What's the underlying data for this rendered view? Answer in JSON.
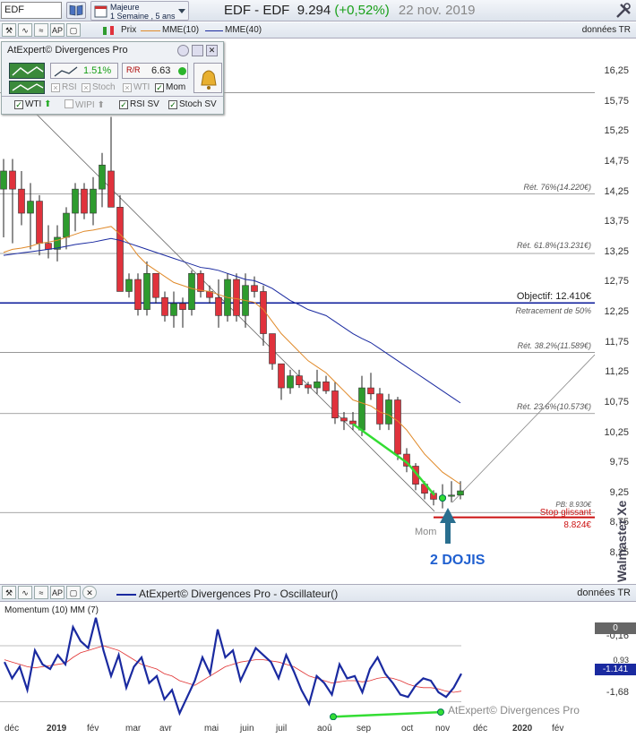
{
  "toolbar": {
    "symbol": "EDF",
    "period_line1": "Majeure",
    "period_line2": "1 Semaine , 5 ans",
    "title_name": "EDF - EDF",
    "title_price": "9.294",
    "title_change": "(+0,52%)",
    "title_date": "22 nov. 2019"
  },
  "legend_bar": {
    "prix": "Prix",
    "mme10": "MME(10)",
    "mme40": "MME(40)",
    "donnees": "données TR"
  },
  "panel": {
    "title": "AtExpert© Divergences Pro",
    "pct": "1.51%",
    "rr": "6.63",
    "checks": [
      {
        "label": "RSI",
        "on": false
      },
      {
        "label": "Stoch",
        "on": false
      },
      {
        "label": "WTI",
        "on": false
      },
      {
        "label": "Mom",
        "on": true
      }
    ],
    "checks2": [
      {
        "label": "WTI",
        "on": true
      },
      {
        "label": "WIPI",
        "on": false
      },
      {
        "label": "RSI SV",
        "on": true
      },
      {
        "label": "Stoch SV",
        "on": true
      }
    ]
  },
  "price_axis": [
    "16,25",
    "15,75",
    "15,25",
    "14,75",
    "14,25",
    "13,75",
    "13,25",
    "12,75",
    "12,25",
    "11,75",
    "11,25",
    "10,75",
    "10,25",
    "9,75",
    "9,25",
    "8,75",
    "8,25"
  ],
  "levels": {
    "ret76": "Rét. 76%(14.220€)",
    "ret618": "Rét. 61.8%(13.231€)",
    "objectif": "Objectif: 12.410€",
    "retr50": "Retracement de 50%",
    "ret382": "Rét. 38.2%(11.589€)",
    "ret236": "Rét. 23.6%(10.573€)",
    "pb": "PB: 8.930€",
    "stop": "Stop glissant",
    "stop_val": "8.824€"
  },
  "annotations": {
    "mom": "Mom",
    "dojis": "2 DOJIS"
  },
  "oscillator_bar": {
    "title": "AtExpert© Divergences Pro - Oscillateur()",
    "donnees": "données TR"
  },
  "oscillator": {
    "label": "Momentum (10) MM (7)",
    "axis": [
      "-0,16",
      "0,93",
      "-1,68"
    ],
    "badge_zero": "0",
    "badge_val": "-1.141",
    "copyright": "AtExpert© Divergences Pro"
  },
  "x_axis": [
    {
      "label": "déc",
      "bold": false
    },
    {
      "label": "2019",
      "bold": true
    },
    {
      "label": "fév",
      "bold": false
    },
    {
      "label": "mar",
      "bold": false
    },
    {
      "label": "avr",
      "bold": false
    },
    {
      "label": "mai",
      "bold": false
    },
    {
      "label": "juin",
      "bold": false
    },
    {
      "label": "juil",
      "bold": false
    },
    {
      "label": "aoû",
      "bold": false
    },
    {
      "label": "sep",
      "bold": false
    },
    {
      "label": "oct",
      "bold": false
    },
    {
      "label": "nov",
      "bold": false
    },
    {
      "label": "déc",
      "bold": false
    },
    {
      "label": "2020",
      "bold": true
    },
    {
      "label": "fév",
      "bold": false
    }
  ],
  "watermark": "Walmaster Xe",
  "colors": {
    "up": "#2e9b2e",
    "down": "#e0323c",
    "mme10": "#e08a2a",
    "mme40": "#1a2aa0",
    "objective": "#0a1a9a",
    "stop": "#cc1111",
    "divergence": "#33dd33",
    "arrow": "#2a6f8f"
  },
  "chart_data": {
    "type": "candlestick",
    "price_min": 8.0,
    "price_max": 16.5,
    "candles": [
      {
        "o": 14.3,
        "h": 14.8,
        "l": 13.5,
        "c": 14.6
      },
      {
        "o": 14.6,
        "h": 14.8,
        "l": 13.4,
        "c": 14.3
      },
      {
        "o": 14.3,
        "h": 14.6,
        "l": 13.7,
        "c": 13.9
      },
      {
        "o": 13.9,
        "h": 14.4,
        "l": 13.3,
        "c": 14.1
      },
      {
        "o": 14.1,
        "h": 14.2,
        "l": 13.2,
        "c": 13.4
      },
      {
        "o": 13.4,
        "h": 13.7,
        "l": 13.15,
        "c": 13.3
      },
      {
        "o": 13.3,
        "h": 13.7,
        "l": 13.1,
        "c": 13.5
      },
      {
        "o": 13.5,
        "h": 14.0,
        "l": 13.3,
        "c": 13.9
      },
      {
        "o": 13.9,
        "h": 14.4,
        "l": 13.6,
        "c": 14.3
      },
      {
        "o": 14.3,
        "h": 14.4,
        "l": 13.8,
        "c": 13.9
      },
      {
        "o": 13.9,
        "h": 14.5,
        "l": 13.7,
        "c": 14.3
      },
      {
        "o": 14.3,
        "h": 14.9,
        "l": 14.0,
        "c": 14.7
      },
      {
        "o": 14.6,
        "h": 15.5,
        "l": 14.2,
        "c": 14.0
      },
      {
        "o": 14.0,
        "h": 14.2,
        "l": 12.9,
        "c": 12.6
      },
      {
        "o": 12.6,
        "h": 12.9,
        "l": 12.5,
        "c": 12.8
      },
      {
        "o": 12.8,
        "h": 12.9,
        "l": 12.2,
        "c": 12.3
      },
      {
        "o": 12.3,
        "h": 13.1,
        "l": 12.2,
        "c": 12.9
      },
      {
        "o": 12.9,
        "h": 12.9,
        "l": 12.4,
        "c": 12.5
      },
      {
        "o": 12.5,
        "h": 12.6,
        "l": 12.1,
        "c": 12.2
      },
      {
        "o": 12.2,
        "h": 12.6,
        "l": 12.0,
        "c": 12.4
      },
      {
        "o": 12.4,
        "h": 12.5,
        "l": 12.0,
        "c": 12.3
      },
      {
        "o": 12.3,
        "h": 12.95,
        "l": 12.2,
        "c": 12.9
      },
      {
        "o": 12.9,
        "h": 12.95,
        "l": 12.5,
        "c": 12.6
      },
      {
        "o": 12.6,
        "h": 12.7,
        "l": 12.4,
        "c": 12.5
      },
      {
        "o": 12.5,
        "h": 12.8,
        "l": 12.0,
        "c": 12.2
      },
      {
        "o": 12.2,
        "h": 12.9,
        "l": 12.1,
        "c": 12.8
      },
      {
        "o": 12.8,
        "h": 12.9,
        "l": 12.1,
        "c": 12.2
      },
      {
        "o": 12.2,
        "h": 12.9,
        "l": 12.0,
        "c": 12.7
      },
      {
        "o": 12.7,
        "h": 12.85,
        "l": 12.5,
        "c": 12.6
      },
      {
        "o": 12.6,
        "h": 12.7,
        "l": 11.7,
        "c": 11.9
      },
      {
        "o": 11.9,
        "h": 11.9,
        "l": 11.3,
        "c": 11.4
      },
      {
        "o": 11.4,
        "h": 11.4,
        "l": 10.8,
        "c": 11.0
      },
      {
        "o": 11.0,
        "h": 11.3,
        "l": 10.9,
        "c": 11.2
      },
      {
        "o": 11.2,
        "h": 11.3,
        "l": 11.0,
        "c": 11.05
      },
      {
        "o": 11.05,
        "h": 11.1,
        "l": 10.9,
        "c": 11.0
      },
      {
        "o": 11.0,
        "h": 11.3,
        "l": 10.9,
        "c": 11.1
      },
      {
        "o": 11.1,
        "h": 11.2,
        "l": 10.9,
        "c": 10.95
      },
      {
        "o": 10.95,
        "h": 11.1,
        "l": 10.4,
        "c": 10.5
      },
      {
        "o": 10.5,
        "h": 10.6,
        "l": 10.3,
        "c": 10.45
      },
      {
        "o": 10.45,
        "h": 10.6,
        "l": 10.3,
        "c": 10.4
      },
      {
        "o": 10.3,
        "h": 11.2,
        "l": 10.2,
        "c": 11.0
      },
      {
        "o": 11.0,
        "h": 11.25,
        "l": 10.8,
        "c": 10.9
      },
      {
        "o": 10.9,
        "h": 11.0,
        "l": 10.3,
        "c": 10.4
      },
      {
        "o": 10.4,
        "h": 10.9,
        "l": 10.3,
        "c": 10.8
      },
      {
        "o": 10.8,
        "h": 10.85,
        "l": 9.8,
        "c": 9.9
      },
      {
        "o": 9.9,
        "h": 10.0,
        "l": 9.6,
        "c": 9.7
      },
      {
        "o": 9.7,
        "h": 9.75,
        "l": 9.3,
        "c": 9.4
      },
      {
        "o": 9.4,
        "h": 9.45,
        "l": 9.15,
        "c": 9.25
      },
      {
        "o": 9.25,
        "h": 9.3,
        "l": 9.05,
        "c": 9.15
      },
      {
        "o": 9.15,
        "h": 9.4,
        "l": 9.0,
        "c": 9.2
      },
      {
        "o": 9.2,
        "h": 9.45,
        "l": 9.1,
        "c": 9.22
      },
      {
        "o": 9.22,
        "h": 9.45,
        "l": 9.15,
        "c": 9.29
      }
    ],
    "mme10": [
      13.25,
      13.3,
      13.32,
      13.35,
      13.4,
      13.42,
      13.45,
      13.5,
      13.55,
      13.6,
      13.62,
      13.65,
      13.68,
      13.55,
      13.4,
      13.2,
      13.05,
      12.95,
      12.85,
      12.75,
      12.7,
      12.65,
      12.62,
      12.6,
      12.55,
      12.5,
      12.48,
      12.45,
      12.42,
      12.3,
      12.1,
      11.9,
      11.75,
      11.6,
      11.45,
      11.35,
      11.25,
      11.1,
      10.95,
      10.8,
      10.75,
      10.7,
      10.6,
      10.55,
      10.45,
      10.3,
      10.1,
      9.9,
      9.75,
      9.6,
      9.5,
      9.4
    ],
    "mme40": [
      13.2,
      13.22,
      13.24,
      13.26,
      13.28,
      13.3,
      13.32,
      13.35,
      13.38,
      13.4,
      13.42,
      13.45,
      13.48,
      13.45,
      13.4,
      13.35,
      13.3,
      13.25,
      13.2,
      13.15,
      13.1,
      13.05,
      13.0,
      12.98,
      12.95,
      12.9,
      12.85,
      12.8,
      12.78,
      12.72,
      12.65,
      12.55,
      12.45,
      12.38,
      12.3,
      12.25,
      12.2,
      12.1,
      12.0,
      11.9,
      11.82,
      11.75,
      11.65,
      11.55,
      11.45,
      11.35,
      11.25,
      11.15,
      11.05,
      10.95,
      10.85,
      10.75
    ],
    "momentum": [
      0.3,
      -0.4,
      0.1,
      -0.9,
      0.8,
      0.2,
      0.0,
      0.6,
      0.2,
      1.8,
      1.2,
      0.9,
      2.2,
      0.8,
      -0.3,
      0.6,
      -0.8,
      0.1,
      0.5,
      -0.6,
      -0.3,
      -1.3,
      -0.9,
      -1.9,
      -1.2,
      -0.5,
      0.5,
      -0.2,
      1.7,
      0.5,
      0.8,
      -0.5,
      0.2,
      0.9,
      0.6,
      0.3,
      -0.4,
      0.6,
      -0.1,
      -0.9,
      -1.5,
      -0.3,
      -0.6,
      -1.1,
      0.2,
      -0.4,
      -0.3,
      -1.0,
      0.0,
      0.5,
      -0.2,
      -0.6,
      -1.1,
      -1.2,
      -0.7,
      -0.4,
      -0.5,
      -1.0,
      -1.2,
      -0.8,
      -0.2
    ],
    "mom_ma": [
      0.4,
      0.3,
      0.2,
      0.1,
      0.05,
      0.1,
      0.15,
      0.2,
      0.25,
      0.5,
      0.7,
      0.8,
      0.9,
      1.0,
      0.9,
      0.8,
      0.6,
      0.4,
      0.2,
      0.1,
      0.0,
      -0.2,
      -0.3,
      -0.5,
      -0.6,
      -0.7,
      -0.5,
      -0.3,
      -0.1,
      0.1,
      0.2,
      0.3,
      0.35,
      0.4,
      0.4,
      0.35,
      0.3,
      0.2,
      0.1,
      -0.1,
      -0.3,
      -0.4,
      -0.5,
      -0.6,
      -0.55,
      -0.5,
      -0.5,
      -0.55,
      -0.5,
      -0.4,
      -0.35,
      -0.4,
      -0.5,
      -0.65,
      -0.75,
      -0.8,
      -0.8,
      -0.85,
      -0.95,
      -1.0,
      -0.95
    ]
  }
}
